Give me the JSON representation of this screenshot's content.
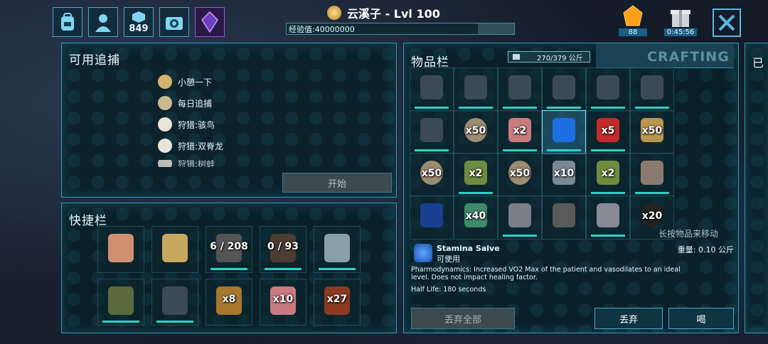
{
  "header": {
    "player_name": "云溪子 - Lvl 100",
    "xp_label": "经验值:40000000",
    "xp_fraction": 0.84,
    "level_icon": "medal-icon",
    "counter_849": "849",
    "gems": "88",
    "timer": "0:45:56",
    "close_icon": "close-icon"
  },
  "top_icons": [
    "backpack-icon",
    "player-icon",
    "engrams-icon",
    "settings-camera-icon",
    "tribe-crystal-icon"
  ],
  "tracking": {
    "title": "可用追捕",
    "items": [
      "小憩一下",
      "每日追捕",
      "狩猎:骇鸟",
      "狩猎:双脊龙",
      "狩猎:树蛙"
    ],
    "start_label": "开始"
  },
  "hotbar": {
    "title": "快捷栏",
    "slots": [
      {
        "icon": "hand-icon",
        "qty": ""
      },
      {
        "icon": "map-compass-icon",
        "qty": ""
      },
      {
        "icon": "rifle-icon",
        "qty": "6 / 208"
      },
      {
        "icon": "shotgun-icon",
        "qty": "0 / 93"
      },
      {
        "icon": "machete-icon",
        "qty": ""
      },
      {
        "icon": "canteen-icon",
        "qty": ""
      },
      {
        "icon": "backpack-item-icon",
        "qty": ""
      },
      {
        "icon": "bowl-icon",
        "qty": "x8"
      },
      {
        "icon": "bottle-icon",
        "qty": "x10"
      },
      {
        "icon": "wood-icon",
        "qty": "x27"
      }
    ]
  },
  "inventory": {
    "title": "物品栏",
    "weight": "270/379 公斤",
    "crafting_tab": "CRAFTING",
    "slots": [
      {
        "icon": "backpack-item-icon",
        "qty": "",
        "c": "#3b4a55"
      },
      {
        "icon": "backpack-item-icon",
        "qty": "",
        "c": "#3b4a55"
      },
      {
        "icon": "backpack-item-icon",
        "qty": "",
        "c": "#3b4a55"
      },
      {
        "icon": "backpack-item-icon",
        "qty": "",
        "c": "#3b4a55"
      },
      {
        "icon": "backpack-item-icon",
        "qty": "",
        "c": "#3b4a55"
      },
      {
        "icon": "backpack-item-icon",
        "qty": "",
        "c": "#3b4a55"
      },
      {
        "icon": "backpack-item-icon",
        "qty": "",
        "c": "#3b4a55"
      },
      {
        "icon": "stone-icon",
        "qty": "x50",
        "c": "#9b8c72"
      },
      {
        "icon": "bottle-icon",
        "qty": "x2",
        "c": "#c97b7f"
      },
      {
        "icon": "stamina-salve-icon",
        "qty": "",
        "c": "#1c6fe0"
      },
      {
        "icon": "feather-dart-icon",
        "qty": "x5",
        "c": "#c42a2a"
      },
      {
        "icon": "bullet-icon",
        "qty": "x50",
        "c": "#b9964e"
      },
      {
        "icon": "stone-icon",
        "qty": "x50",
        "c": "#9b8c72"
      },
      {
        "icon": "green-bottle-icon",
        "qty": "x2",
        "c": "#6f8c3e"
      },
      {
        "icon": "stone-icon",
        "qty": "x50",
        "c": "#9b8c72"
      },
      {
        "icon": "spear-icon",
        "qty": "x10",
        "c": "#7a8a94"
      },
      {
        "icon": "green-bottle-icon",
        "qty": "x2",
        "c": "#6f8c3e"
      },
      {
        "icon": "gloves-forbidden-icon",
        "qty": "",
        "c": "#8a7a70"
      },
      {
        "icon": "blue-crystal-icon",
        "qty": "",
        "c": "#1a3f90"
      },
      {
        "icon": "fiber-icon",
        "qty": "x40",
        "c": "#3f8a6a"
      },
      {
        "icon": "gauntlet-icon",
        "qty": "",
        "c": "#7a7f8a"
      },
      {
        "icon": "tool-icon",
        "qty": "",
        "c": "#5a5a5a"
      },
      {
        "icon": "claw-icon",
        "qty": "",
        "c": "#8a8a96"
      },
      {
        "icon": "black-orbs-icon",
        "qty": "x20",
        "c": "#222"
      }
    ],
    "move_hint": "长按物品来移动"
  },
  "item_detail": {
    "name": "Stamina Salve",
    "usable": "可使用",
    "weight": "重量: 0.10 公斤",
    "description": "Pharmodynamics: Increased VO2 Max of the patient and vasodilates to an ideal level. Does not impact healing factor.",
    "half_life": "Half Life: 180 seconds"
  },
  "actions": {
    "drop_all": "丢弃全部",
    "drop": "丢弃",
    "drink": "喝"
  },
  "right_edge": "已"
}
